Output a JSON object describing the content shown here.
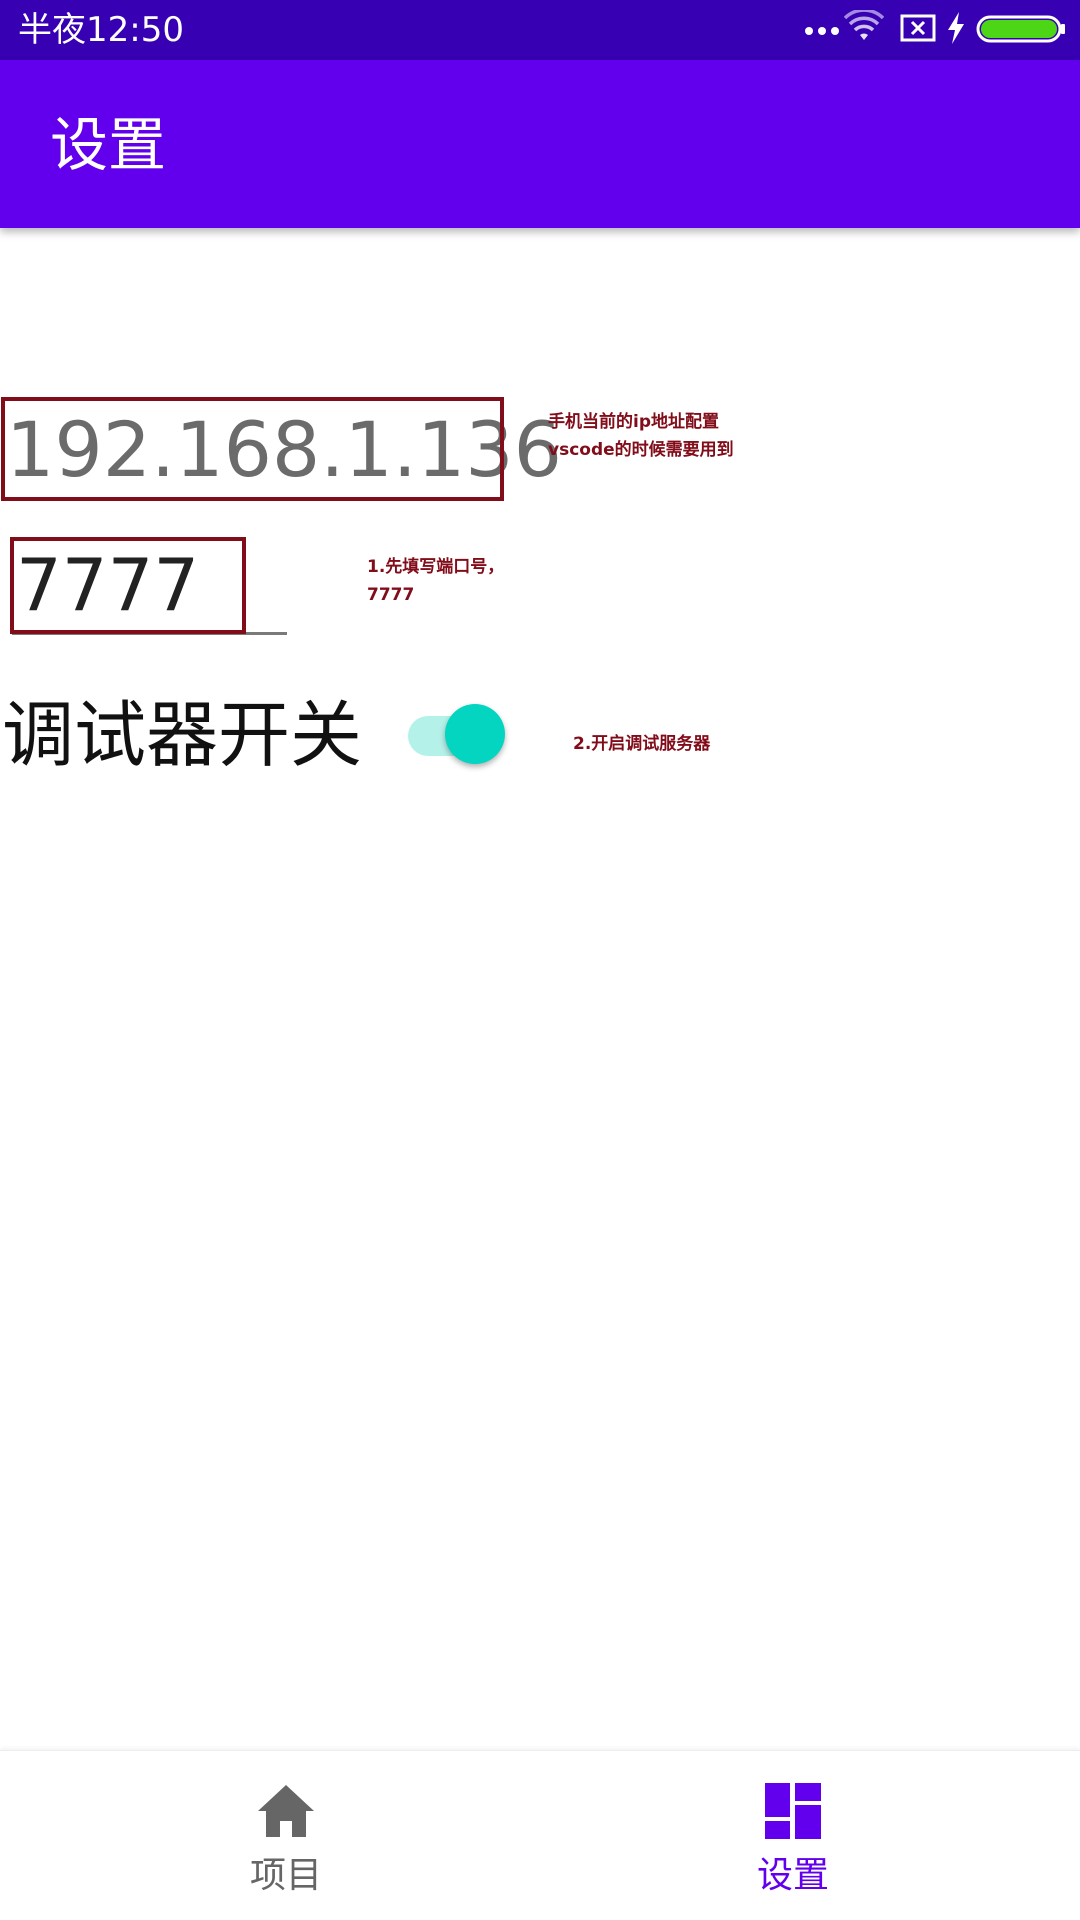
{
  "status_bar": {
    "time": "半夜12:50",
    "icons": [
      "more-dots-icon",
      "wifi-icon",
      "no-sim-icon",
      "charging-bolt-icon",
      "battery-icon"
    ]
  },
  "app_bar": {
    "title": "设置"
  },
  "ip": {
    "value": "192.168.1.136",
    "note": "手机当前的ip地址配置vscode的时候需要用到"
  },
  "port": {
    "value": "7777",
    "note": "1.先填写端口号，7777"
  },
  "debugger": {
    "label": "调试器开关",
    "enabled": true,
    "note": "2.开启调试服务器"
  },
  "bottom_nav": {
    "items": [
      {
        "label": "项目",
        "icon": "home-icon",
        "active": false
      },
      {
        "label": "设置",
        "icon": "dashboard-icon",
        "active": true
      }
    ]
  },
  "colors": {
    "status_bar": "#3700b3",
    "app_bar": "#6200ee",
    "annotation": "#820d1a",
    "switch_thumb": "#03d5c1",
    "switch_track": "#b4f1e9",
    "nav_active": "#6200ee",
    "nav_inactive": "#666666",
    "battery": "#4cd616"
  }
}
